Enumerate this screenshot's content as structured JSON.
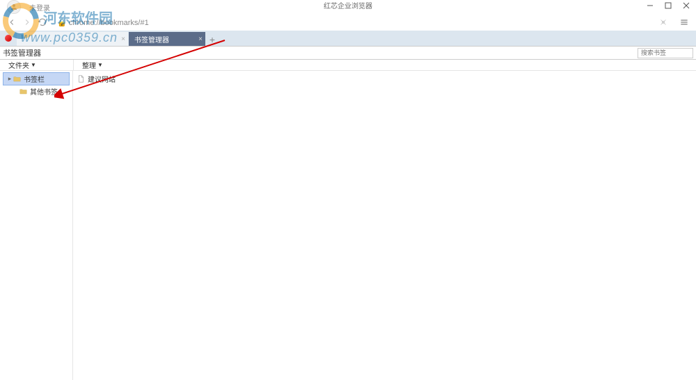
{
  "titlebar": {
    "login_status": "未登录",
    "title": "红芯企业浏览器"
  },
  "address": {
    "url": "chrome://bookmarks/#1"
  },
  "tabs": [
    {
      "label": "",
      "active": false
    },
    {
      "label": "书签管理器",
      "active": true
    }
  ],
  "subheader": {
    "title": "书签管理器",
    "search_placeholder": "搜索书签"
  },
  "toolbars": {
    "folders_label": "文件夹",
    "manage_label": "整理"
  },
  "tree": {
    "items": [
      {
        "label": "书签栏",
        "selected": true,
        "expandable": true
      },
      {
        "label": "其他书签",
        "selected": false,
        "expandable": false
      }
    ]
  },
  "list": {
    "items": [
      {
        "label": "建议网站"
      }
    ]
  },
  "watermark": {
    "site_name": "河东软件园",
    "url": "www.pc0359.cn"
  }
}
